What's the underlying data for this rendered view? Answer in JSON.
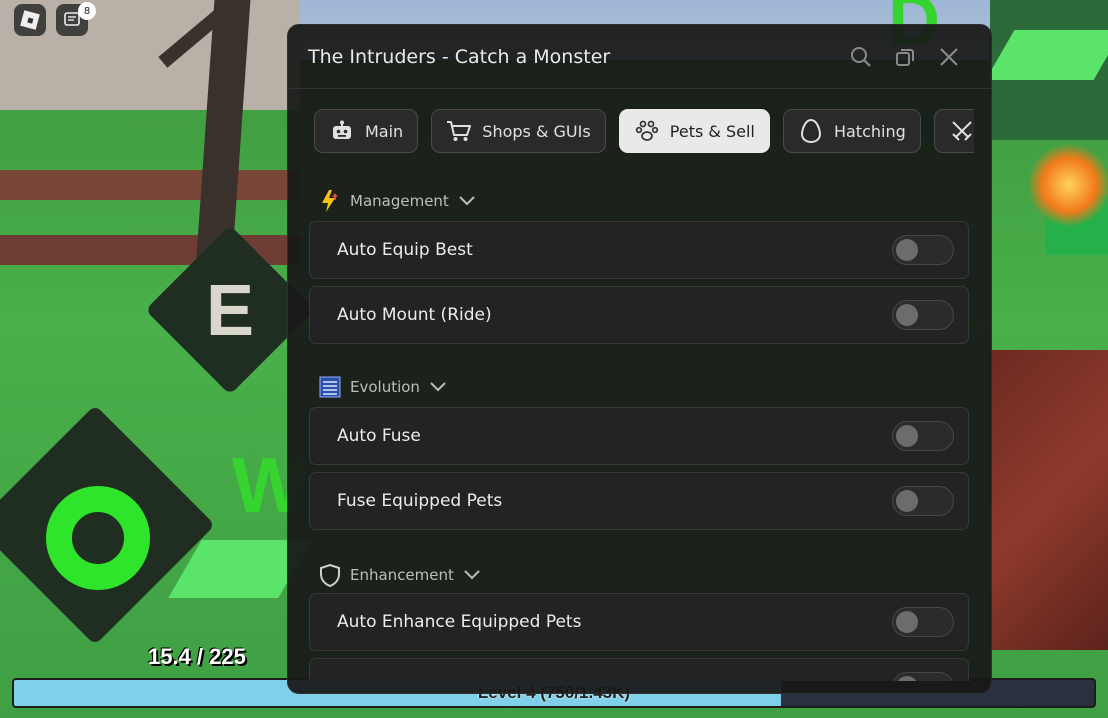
{
  "hud": {
    "health_text": "15.4 / 225",
    "xp_label": "Level 4 (750/1.43K)",
    "xp_progress": 0.71,
    "chat_badge_count": "8",
    "key_e": "E",
    "key_w": "W",
    "key_d": "D"
  },
  "window": {
    "title": "The Intruders - Catch a Monster",
    "controls": [
      "search-icon",
      "restore-icon",
      "close-icon"
    ]
  },
  "tabs": [
    {
      "label": "Main",
      "icon": "robot-icon",
      "active": false
    },
    {
      "label": "Shops & GUIs",
      "icon": "cart-icon",
      "active": false
    },
    {
      "label": "Pets & Sell",
      "icon": "paw-icon",
      "active": true
    },
    {
      "label": "Hatching",
      "icon": "egg-icon",
      "active": false
    },
    {
      "label": "",
      "icon": "swords-icon",
      "active": false
    }
  ],
  "sections": {
    "management": {
      "title": "Management",
      "icon": "lightning-icon",
      "rows": [
        {
          "label": "Auto Equip Best",
          "on": false
        },
        {
          "label": "Auto Mount (Ride)",
          "on": false
        }
      ]
    },
    "evolution": {
      "title": "Evolution",
      "icon": "list-icon",
      "rows": [
        {
          "label": "Auto Fuse",
          "on": false
        },
        {
          "label": "Fuse Equipped Pets",
          "on": false
        }
      ]
    },
    "enhancement": {
      "title": "Enhancement",
      "icon": "shield-icon",
      "rows": [
        {
          "label": "Auto Enhance Equipped Pets",
          "on": false
        }
      ]
    }
  },
  "colors": {
    "window_bg": "#181818",
    "tab_active_bg": "#e9e9e9",
    "toggle_off": "#6c6c6c",
    "xp_fill": "#7fd0e8",
    "game_green": "#35d42f"
  }
}
